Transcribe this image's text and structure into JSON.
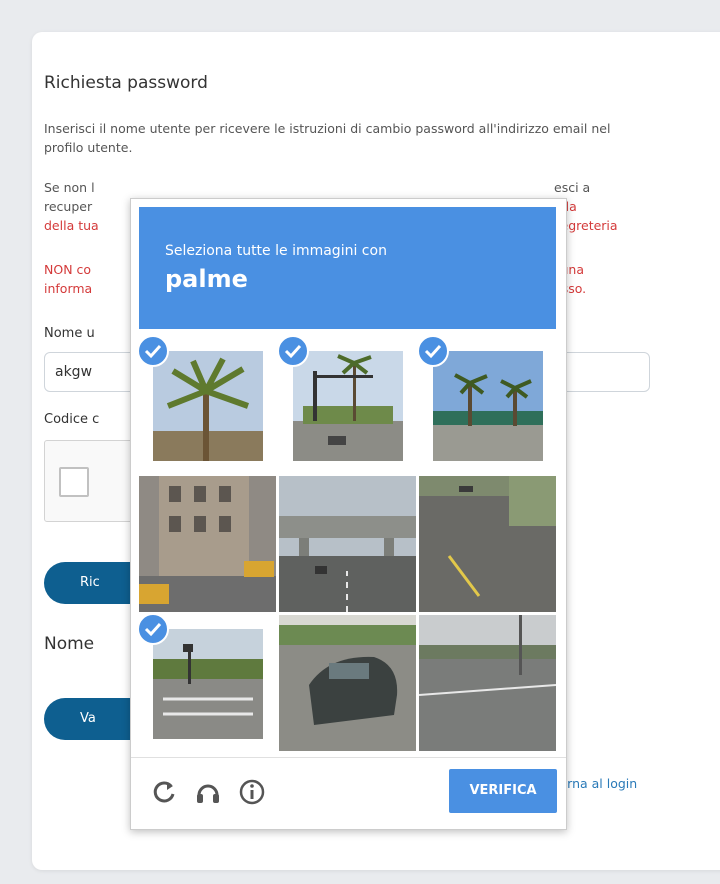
{
  "page": {
    "title": "Richiesta password",
    "paragraph1": "Inserisci il nome utente per ricevere le istruzioni di cambio password all'indirizzo email nel profilo utente.",
    "paragraph2_line1": "Se non l",
    "paragraph2_line1_end": "esci a",
    "paragraph2_line2": "recuper",
    "paragraph2_line2_end": "e la segreteria",
    "paragraph2_line3": "della tua",
    "paragraph3_line1": "NON co",
    "paragraph3_line1_end": "suna",
    "paragraph3_line2": "informa",
    "paragraph3_line2_end": "esso.",
    "username_label": "Nome u",
    "username_value": "akgw",
    "code_label": "Codice c",
    "button1_label": "Ric",
    "heading2": "Nome",
    "button2_label": "Va",
    "back_link": "Torna al login"
  },
  "captcha": {
    "instruction": "Seleziona tutte le immagini con",
    "target": "palme",
    "verify_label": "VERIFICA",
    "tiles": [
      {
        "id": 1,
        "selected": true
      },
      {
        "id": 2,
        "selected": true
      },
      {
        "id": 3,
        "selected": true
      },
      {
        "id": 4,
        "selected": false
      },
      {
        "id": 5,
        "selected": false
      },
      {
        "id": 6,
        "selected": false
      },
      {
        "id": 7,
        "selected": true
      },
      {
        "id": 8,
        "selected": false
      },
      {
        "id": 9,
        "selected": false
      }
    ],
    "icons": [
      "reload-icon",
      "audio-icon",
      "info-icon"
    ],
    "accent_color": "#4a90e2"
  },
  "colors": {
    "primary_button": "#0e5f90",
    "warning_text": "#d43a3a",
    "link": "#2a7ab8"
  }
}
